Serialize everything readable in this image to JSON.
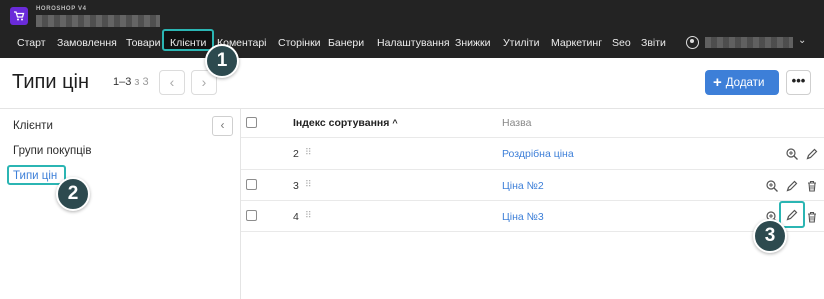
{
  "app": {
    "brand": "HOROSHOP V4"
  },
  "nav": {
    "items": [
      {
        "label": "Старт"
      },
      {
        "label": "Замовлення"
      },
      {
        "label": "Товари"
      },
      {
        "label": "Клієнти",
        "active": true
      },
      {
        "label": "Коментарі"
      },
      {
        "label": "Сторінки"
      },
      {
        "label": "Банери"
      },
      {
        "label": "Налаштування"
      },
      {
        "label": "Знижки"
      },
      {
        "label": "Утиліти"
      },
      {
        "label": "Маркетинг"
      },
      {
        "label": "Seo"
      },
      {
        "label": "Звіти"
      }
    ]
  },
  "page": {
    "title": "Типи цін",
    "pager_range": "1–3",
    "pager_of": "з 3",
    "prev": "‹",
    "next": "›",
    "add_icon": "+",
    "add_label": "Додати",
    "more_label": "•••"
  },
  "sidebar": {
    "collapse": "‹",
    "items": [
      {
        "label": "Клієнти"
      },
      {
        "label": "Групи покупців"
      },
      {
        "label": "Типи цін",
        "active": true
      }
    ]
  },
  "table": {
    "headers": {
      "sort": "Індекс сортування",
      "sort_arrow": "^",
      "name": "Назва"
    },
    "rows": [
      {
        "index": "2",
        "name": "Роздрібна ціна",
        "has_checkbox": false,
        "actions": [
          "zoom-icon",
          "pencil-icon"
        ]
      },
      {
        "index": "3",
        "name": "Ціна №2",
        "has_checkbox": true,
        "actions": [
          "zoom-icon",
          "pencil-icon",
          "trash-icon"
        ]
      },
      {
        "index": "4",
        "name": "Ціна №3",
        "has_checkbox": true,
        "actions": [
          "zoom-icon",
          "pencil-icon",
          "trash-icon"
        ]
      }
    ]
  },
  "annotations": {
    "steps": [
      "1",
      "2",
      "3"
    ],
    "color": "#2bb5b3",
    "badge_color": "#2d4a4f"
  },
  "colors": {
    "topbar": "#232323",
    "accent": "#3d7fd8",
    "logo": "#6a2bd9"
  }
}
